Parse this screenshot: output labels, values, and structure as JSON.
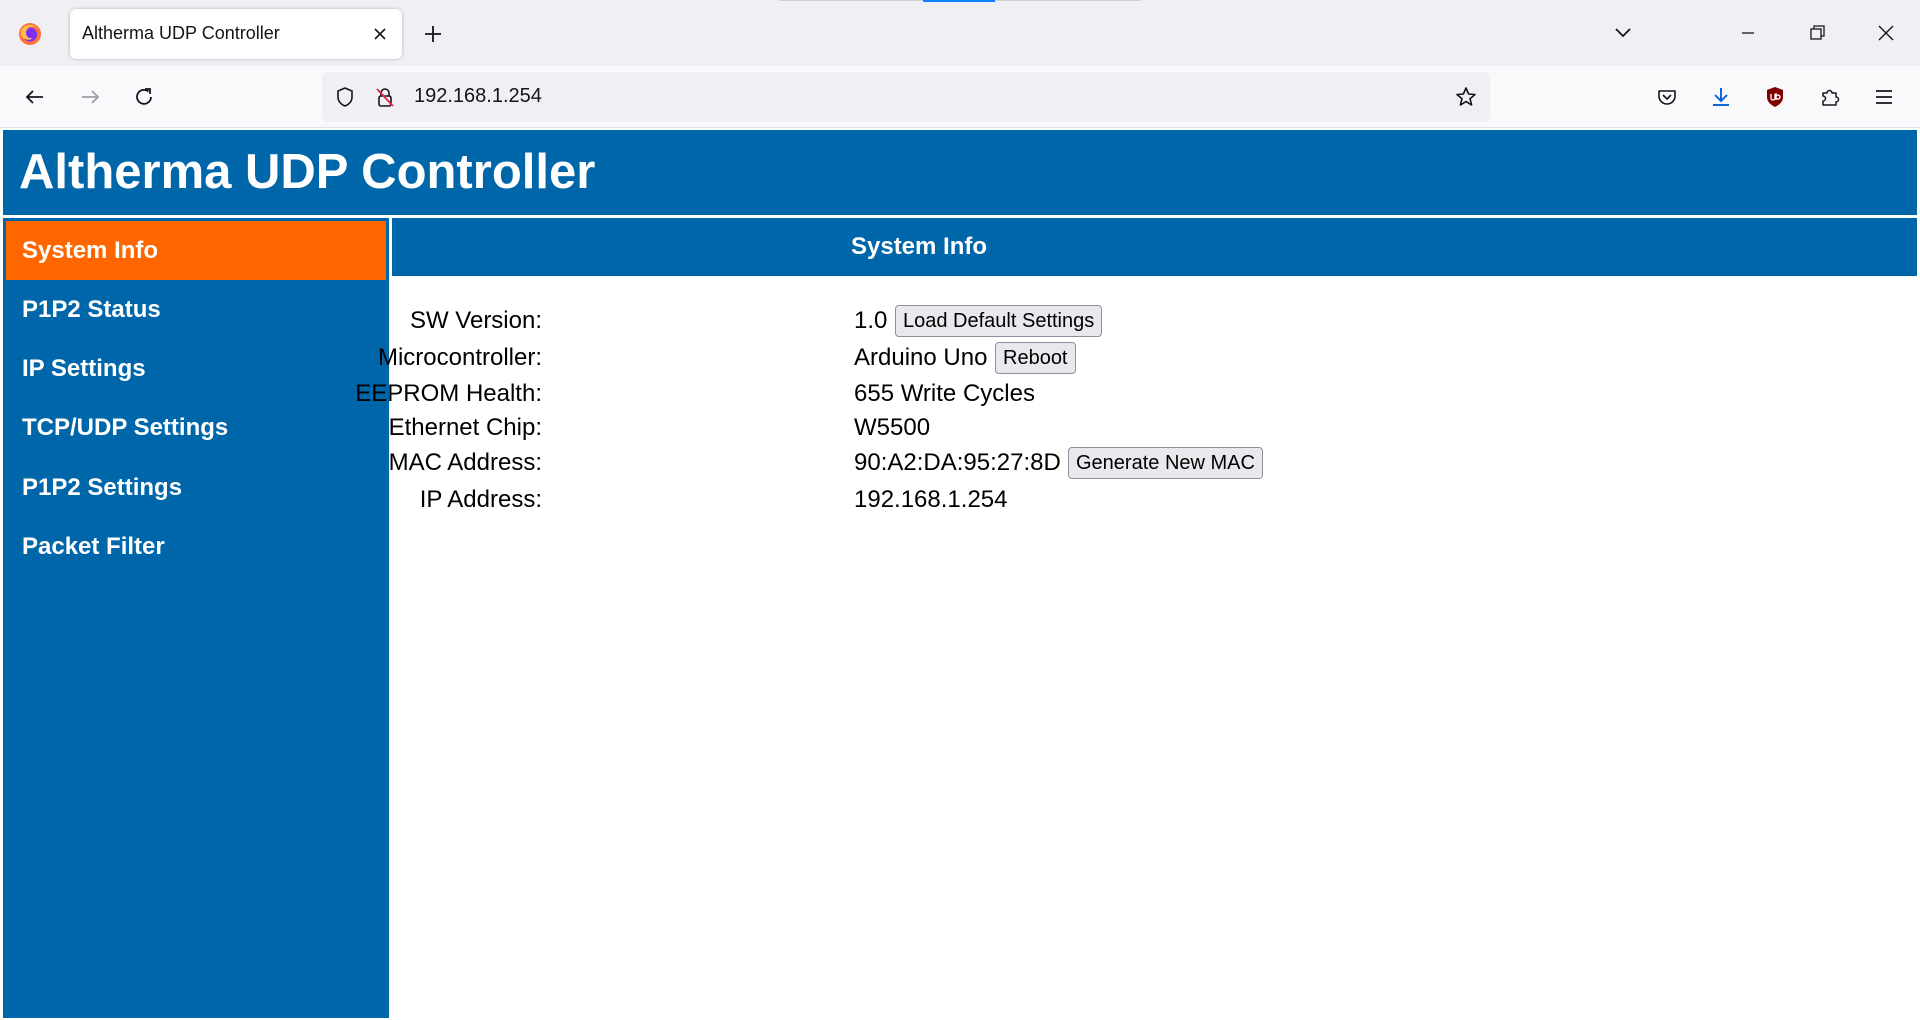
{
  "browser": {
    "tab_title": "Altherma UDP Controller",
    "url": "192.168.1.254"
  },
  "page": {
    "title": "Altherma UDP Controller",
    "header_color": "#0066aa",
    "active_color": "#ff6600"
  },
  "sidebar": {
    "items": [
      {
        "label": "System Info",
        "active": true
      },
      {
        "label": "P1P2 Status"
      },
      {
        "label": "IP Settings"
      },
      {
        "label": "TCP/UDP Settings"
      },
      {
        "label": "P1P2 Settings"
      },
      {
        "label": "Packet Filter"
      }
    ]
  },
  "content": {
    "title": "System Info",
    "rows": [
      {
        "label": "SW Version:",
        "value": "1.0",
        "button": "Load Default Settings"
      },
      {
        "label": "Microcontroller:",
        "value": "Arduino Uno",
        "button": "Reboot"
      },
      {
        "label": "EEPROM Health:",
        "value": "655 Write Cycles"
      },
      {
        "label": "Ethernet Chip:",
        "value": "W5500"
      },
      {
        "label": "MAC Address:",
        "value": "90:A2:DA:95:27:8D",
        "button": "Generate New MAC"
      },
      {
        "label": "IP Address:",
        "value": "192.168.1.254"
      }
    ]
  }
}
